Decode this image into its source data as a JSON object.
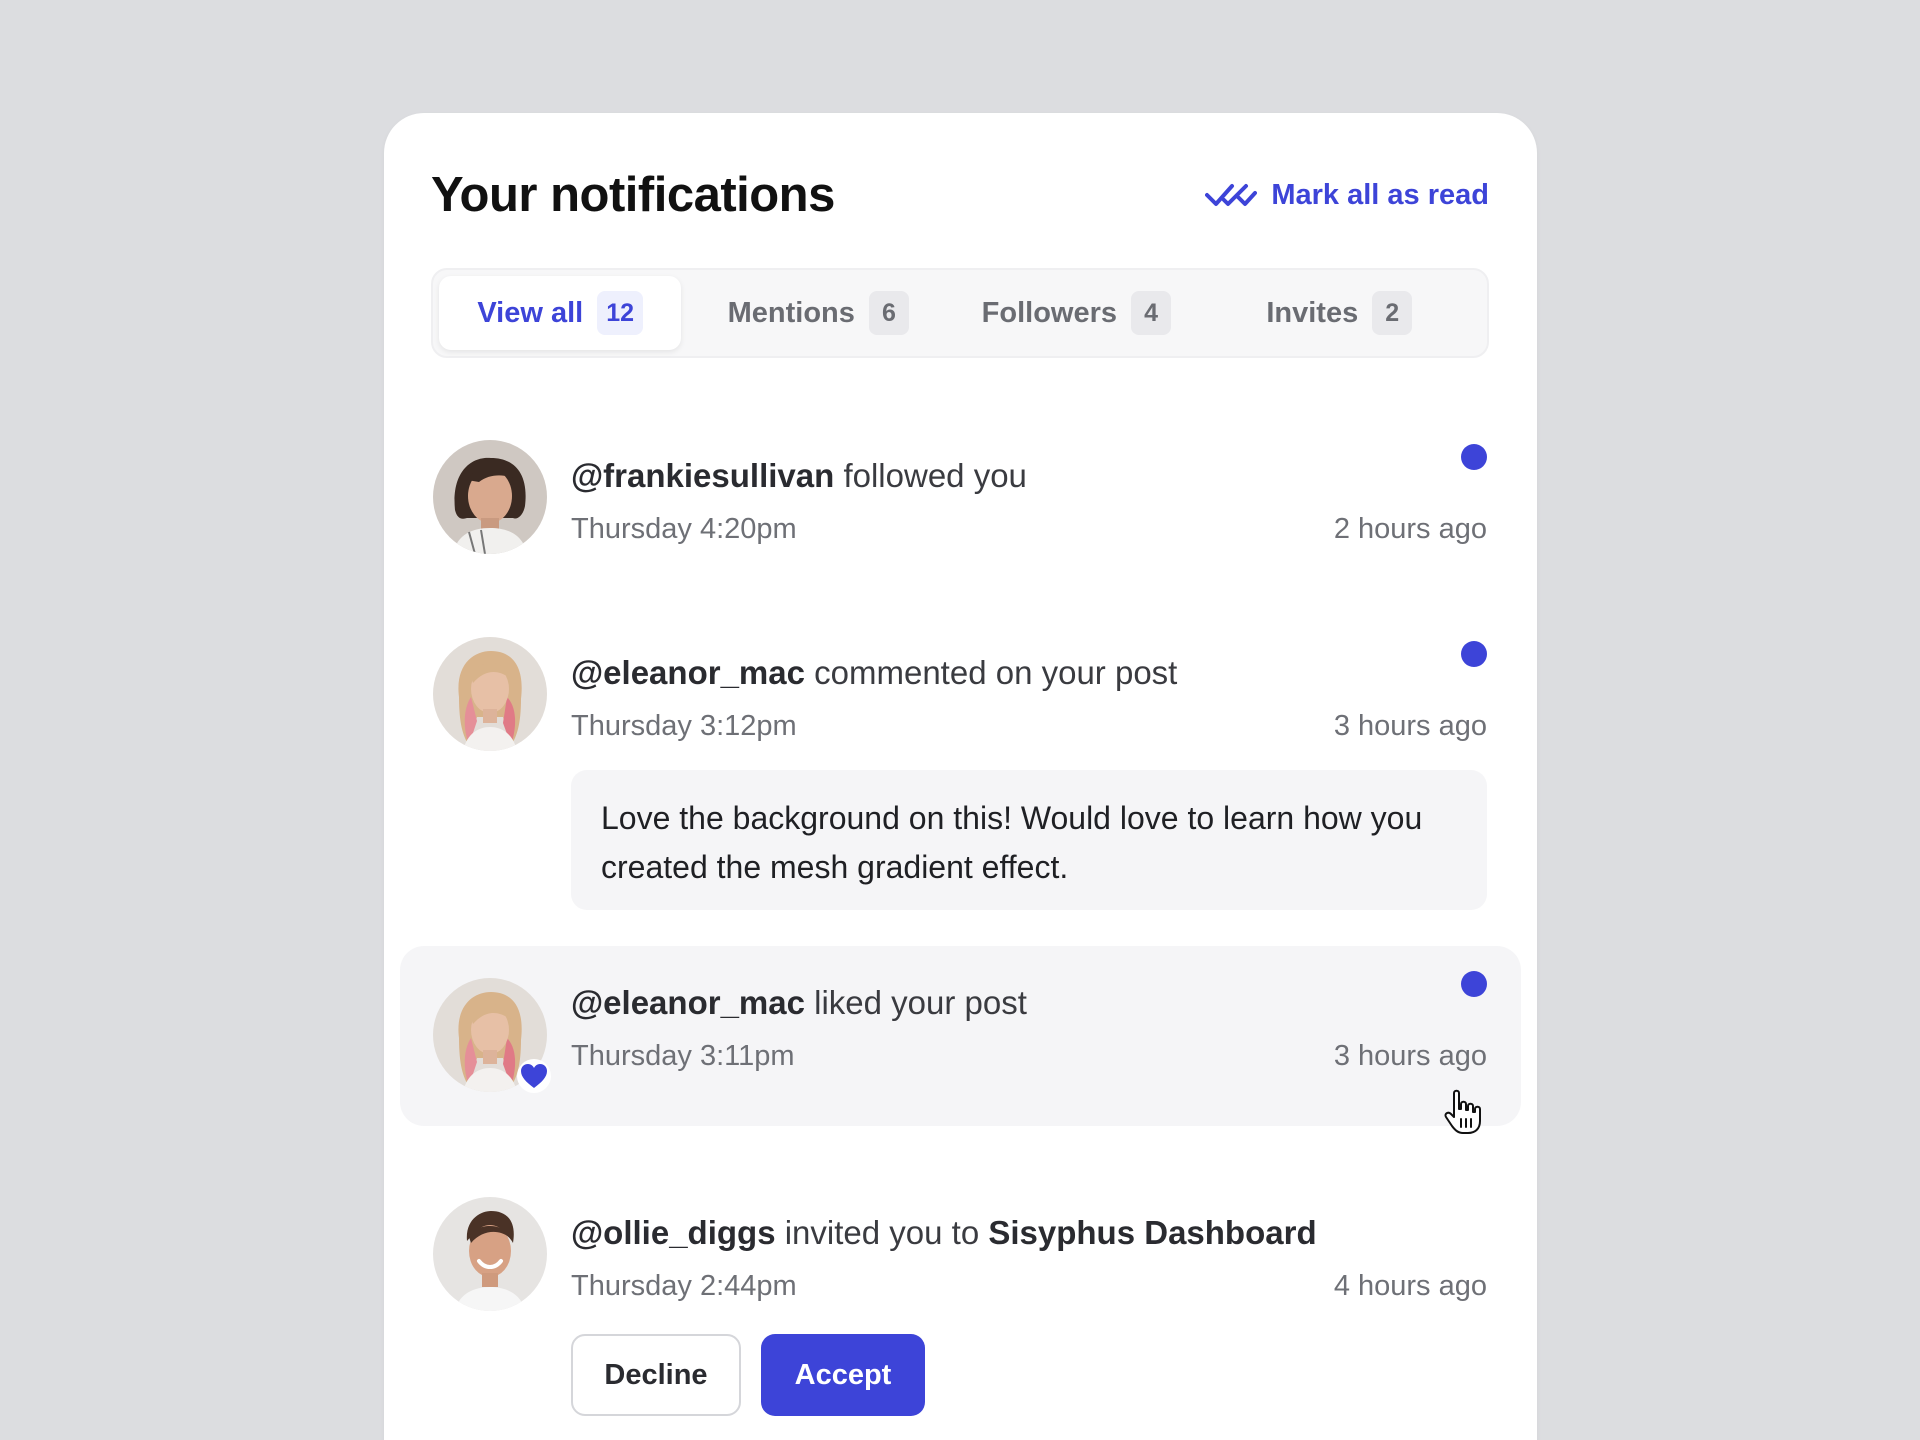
{
  "header": {
    "title": "Your notifications",
    "mark_all_label": "Mark all as read"
  },
  "tabs": [
    {
      "label": "View all",
      "count": "12",
      "active": true
    },
    {
      "label": "Mentions",
      "count": "6"
    },
    {
      "label": "Followers",
      "count": "4"
    },
    {
      "label": "Invites",
      "count": "2"
    }
  ],
  "notifications": [
    {
      "user": "@frankiesullivan",
      "action": "followed you",
      "date": "Thursday 4:20pm",
      "ago": "2 hours ago",
      "unread": true
    },
    {
      "user": "@eleanor_mac",
      "action": "commented on your post",
      "date": "Thursday 3:12pm",
      "ago": "3 hours ago",
      "unread": true,
      "comment": "Love the background on this! Would love to learn how you created the mesh gradient effect."
    },
    {
      "user": "@eleanor_mac",
      "action": "liked your post",
      "date": "Thursday 3:11pm",
      "ago": "3 hours ago",
      "unread": true,
      "icon": "heart-icon"
    },
    {
      "user": "@ollie_diggs",
      "action": "invited you to",
      "target": "Sisyphus Dashboard",
      "date": "Thursday 2:44pm",
      "ago": "4 hours ago",
      "decline_label": "Decline",
      "accept_label": "Accept"
    }
  ],
  "colors": {
    "accent": "#3d44d8",
    "background": "#dcdde0",
    "card": "#ffffff"
  }
}
